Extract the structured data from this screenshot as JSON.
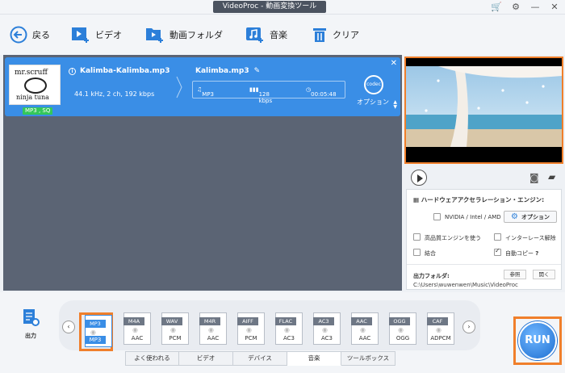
{
  "window": {
    "title": "VideoProc - 動画変換ツール"
  },
  "toolbar": {
    "back": "戻る",
    "video": "ビデオ",
    "video_folder": "動画フォルダ",
    "music": "音楽",
    "clear": "クリア"
  },
  "file": {
    "thumb_line1": "mr.scruff",
    "thumb_line2": "ninja tuna",
    "badge": "MP3 , SQ",
    "source_name": "Kalimba-Kalimba.mp3",
    "source_meta": "44.1 kHz, 2 ch, 192 kbps",
    "output_name": "Kalimba.mp3",
    "output_format": "MP3",
    "output_bitrate": "128 kbps",
    "output_duration": "00:05:48",
    "codec_label": "codec",
    "option_label": "オプション"
  },
  "settings": {
    "hw_title": "ハードウェアアクセラレーション・エンジン:",
    "hw_vendor": "NVIDIA / Intel / AMD",
    "option_button": "オプション",
    "hq_engine": "高品質エンジンを使う",
    "deinterlace": "インターレース解除",
    "merge": "結合",
    "auto_copy": "自動コピー",
    "auto_copy_q": "?",
    "output_folder_label": "出力フォルダ:",
    "browse": "参照",
    "open": "開く",
    "output_path": "C:\\Users\\wuwenwen\\Music\\VideoProc"
  },
  "bottom": {
    "output_label": "出力",
    "formats": [
      {
        "top": "MP3",
        "bottom": "MP3"
      },
      {
        "top": "M4A",
        "bottom": "AAC"
      },
      {
        "top": "WAV",
        "bottom": "PCM"
      },
      {
        "top": "M4R",
        "bottom": "AAC"
      },
      {
        "top": "AIFF",
        "bottom": "PCM"
      },
      {
        "top": "FLAC",
        "bottom": "AC3"
      },
      {
        "top": "AC3",
        "bottom": "AC3"
      },
      {
        "top": "AAC",
        "bottom": "AAC"
      },
      {
        "top": "OGG",
        "bottom": "OGG"
      },
      {
        "top": "CAF",
        "bottom": "ADPCM"
      }
    ],
    "tabs": [
      "よく使われる",
      "ビデオ",
      "デバイス",
      "音楽",
      "ツールボックス"
    ],
    "run": "RUN"
  },
  "colors": {
    "accent": "#3a8ee6",
    "highlight": "#f07f2b",
    "panel": "#5b6474"
  }
}
